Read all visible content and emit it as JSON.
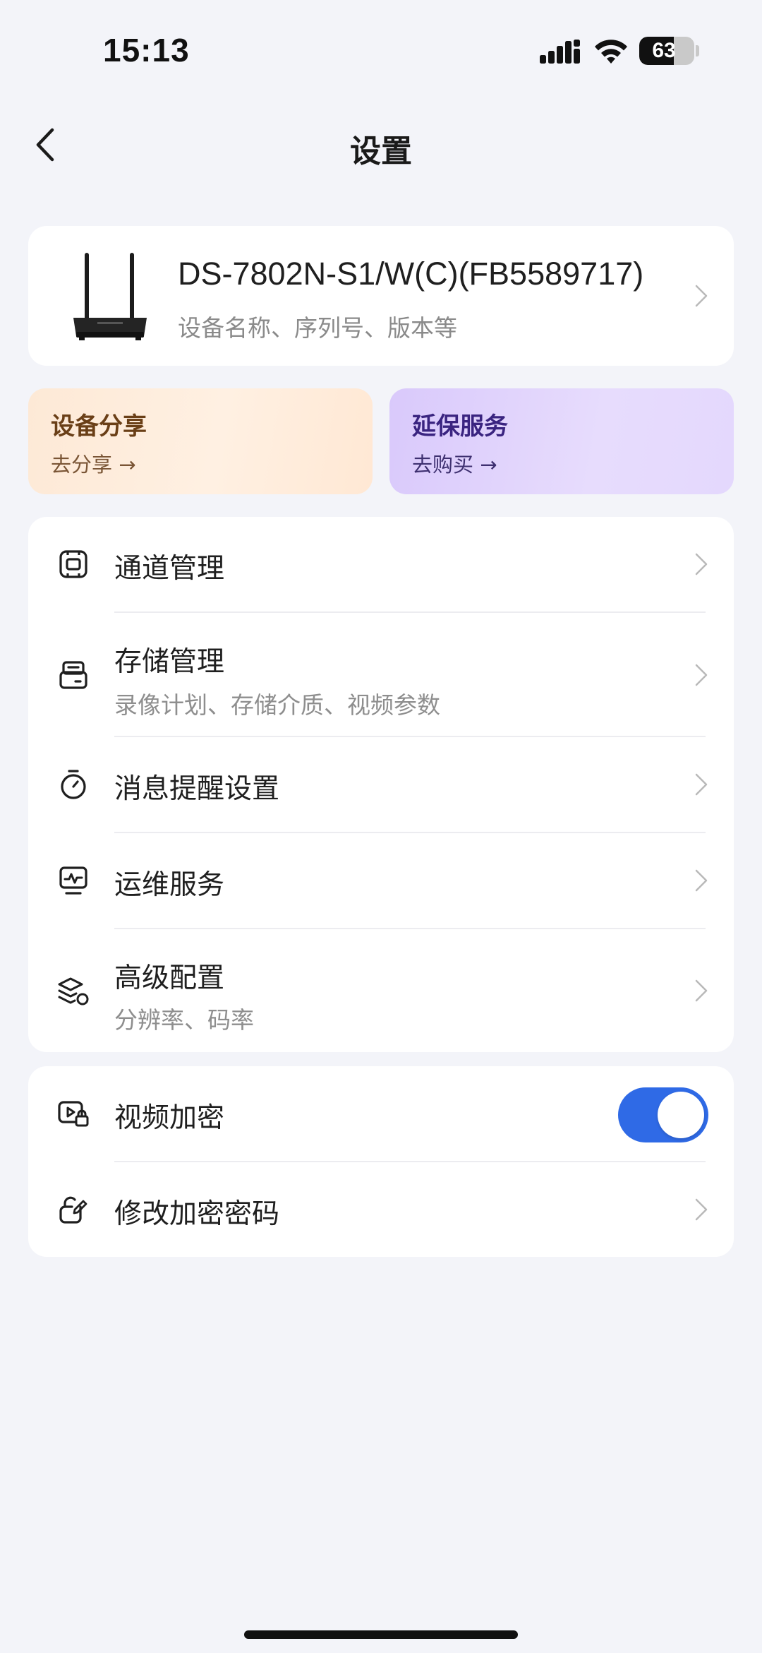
{
  "status_bar": {
    "time": "15:13",
    "battery_percent": "63",
    "battery_level": 0.63
  },
  "nav": {
    "title": "设置"
  },
  "device": {
    "name": "DS-7802N-S1/W(C)(FB5589717)",
    "subtitle": "设备名称、序列号、版本等"
  },
  "promos": {
    "share": {
      "title": "设备分享",
      "link": "去分享 →"
    },
    "warranty": {
      "title": "延保服务",
      "link": "去购买 →"
    }
  },
  "menu": [
    {
      "label": "通道管理",
      "icon": "channel-icon"
    },
    {
      "label": "存储管理",
      "sub": "录像计划、存储介质、视频参数",
      "icon": "storage-icon"
    },
    {
      "label": "消息提醒设置",
      "icon": "timer-icon"
    },
    {
      "label": "运维服务",
      "icon": "monitor-icon"
    },
    {
      "label": "高级配置",
      "sub": "分辨率、码率",
      "icon": "layers-icon"
    }
  ],
  "security": [
    {
      "label": "视频加密",
      "icon": "video-lock-icon",
      "toggle_on": true
    },
    {
      "label": "修改加密密码",
      "icon": "edit-lock-icon"
    }
  ],
  "colors": {
    "accent": "#2f6ae6",
    "background": "#f3f4f9"
  }
}
